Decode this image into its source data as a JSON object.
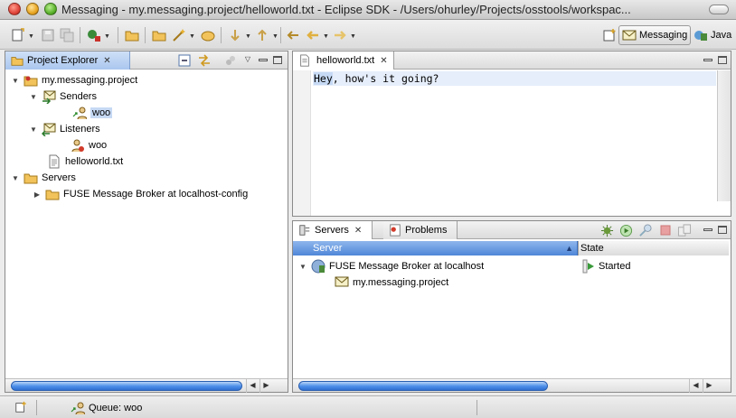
{
  "window": {
    "title": "Messaging - my.messaging.project/helloworld.txt - Eclipse SDK - /Users/ohurley/Projects/osstools/workspac..."
  },
  "perspectives": [
    {
      "label": "Messaging",
      "icon": "messaging-perspective-icon",
      "active": true
    },
    {
      "label": "Java",
      "icon": "java-perspective-icon",
      "active": false
    }
  ],
  "project_explorer": {
    "tab_label": "Project Explorer",
    "tree": [
      {
        "label": "my.messaging.project",
        "icon": "project-folder-icon",
        "expanded": true
      },
      {
        "label": "Senders",
        "icon": "senders-icon",
        "expanded": true
      },
      {
        "label": "woo",
        "icon": "sender-endpoint-icon",
        "selected": true
      },
      {
        "label": "Listeners",
        "icon": "listeners-icon",
        "expanded": true
      },
      {
        "label": "woo",
        "icon": "listener-endpoint-icon"
      },
      {
        "label": "helloworld.txt",
        "icon": "text-file-icon"
      },
      {
        "label": "Servers",
        "icon": "folder-icon",
        "expanded": true
      },
      {
        "label": "FUSE Message Broker at localhost-config",
        "icon": "folder-icon",
        "expanded": false
      }
    ]
  },
  "editor": {
    "tab_label": "helloworld.txt",
    "content_prefix": "Hey",
    "content_rest": ", how's it going?"
  },
  "bottom_panel": {
    "tabs": [
      {
        "label": "Servers",
        "active": true
      },
      {
        "label": "Problems",
        "active": false
      }
    ],
    "columns": {
      "server": "Server",
      "state": "State"
    },
    "rows": [
      {
        "server": "FUSE Message Broker at localhost",
        "state": "Started",
        "icon": "server-icon",
        "state_icon": "started-icon"
      },
      {
        "server": "my.messaging.project",
        "state": "",
        "icon": "module-icon"
      }
    ]
  },
  "status_bar": {
    "text": "Queue: woo"
  },
  "colors": {
    "selection": "#c6d9f4",
    "active_tab_blue": "#a9c6ee",
    "column_header_blue": "#4f86d8"
  }
}
